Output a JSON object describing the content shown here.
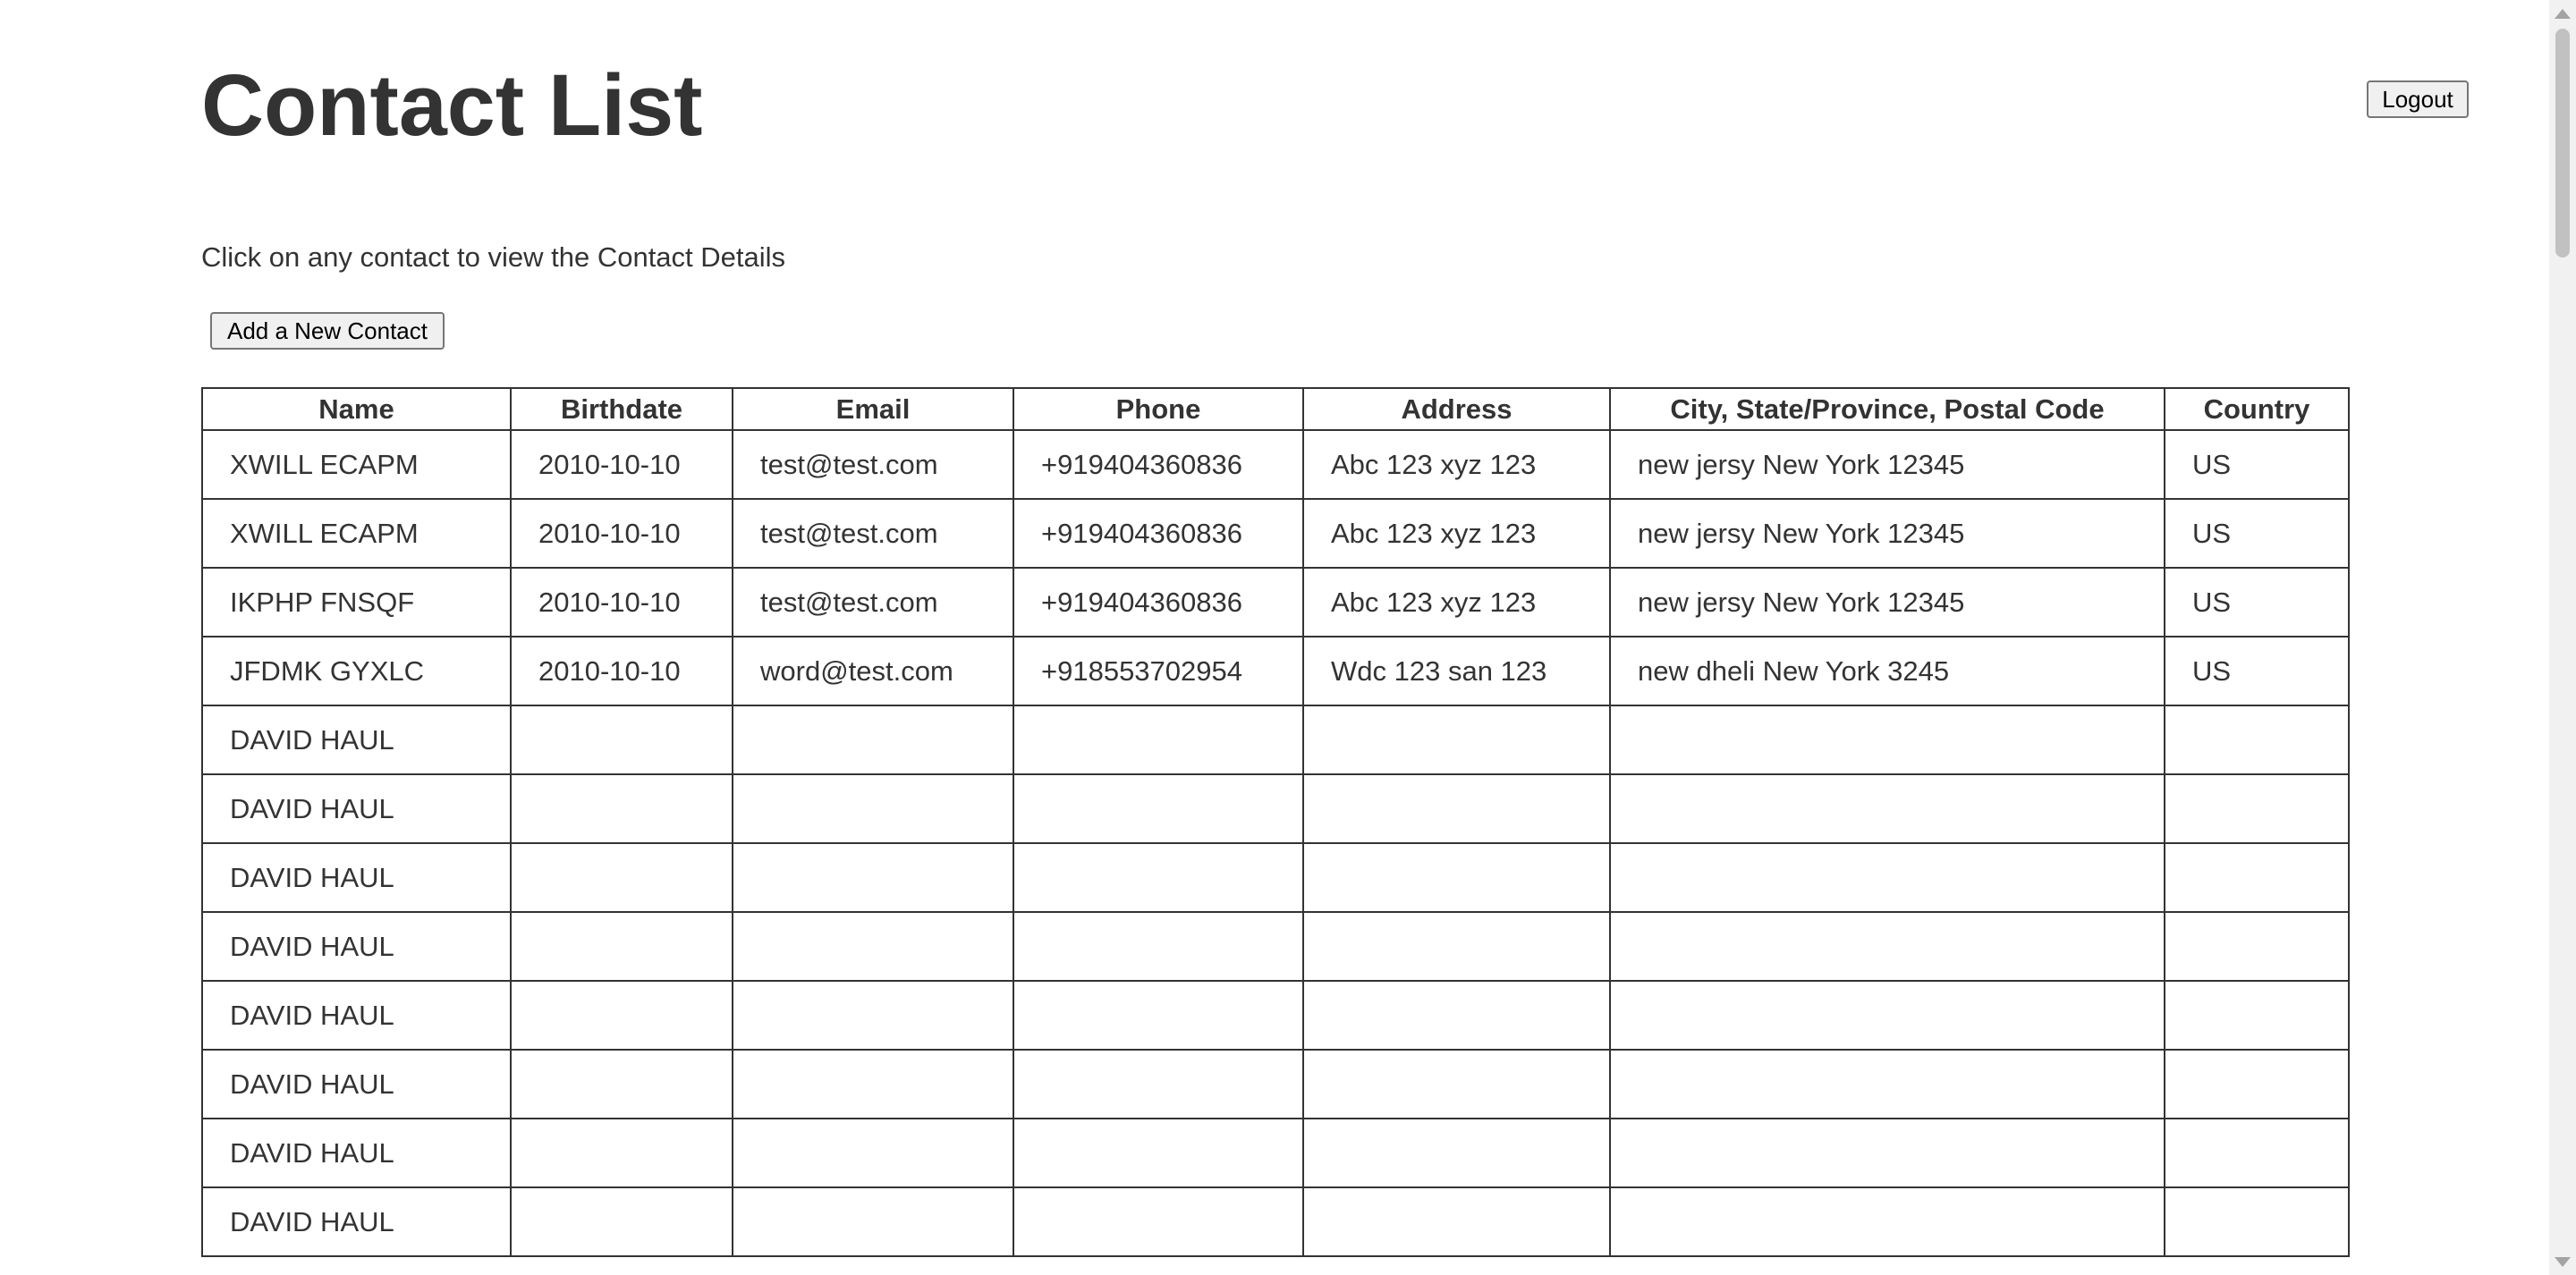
{
  "header": {
    "title": "Contact List",
    "logout_label": "Logout"
  },
  "main": {
    "instructions": "Click on any contact to view the Contact Details",
    "add_contact_label": "Add a New Contact"
  },
  "table": {
    "columns": [
      "Name",
      "Birthdate",
      "Email",
      "Phone",
      "Address",
      "City, State/Province, Postal Code",
      "Country"
    ],
    "rows": [
      [
        "XWILL ECAPM",
        "2010-10-10",
        "test@test.com",
        "+919404360836",
        "Abc 123 xyz 123",
        "new jersy New York 12345",
        "US"
      ],
      [
        "XWILL ECAPM",
        "2010-10-10",
        "test@test.com",
        "+919404360836",
        "Abc 123 xyz 123",
        "new jersy New York 12345",
        "US"
      ],
      [
        "IKPHP FNSQF",
        "2010-10-10",
        "test@test.com",
        "+919404360836",
        "Abc 123 xyz 123",
        "new jersy New York 12345",
        "US"
      ],
      [
        "JFDMK GYXLC",
        "2010-10-10",
        "word@test.com",
        "+918553702954",
        "Wdc 123 san 123",
        "new dheli New York 3245",
        "US"
      ],
      [
        "DAVID HAUL",
        "",
        "",
        "",
        "",
        "",
        ""
      ],
      [
        "DAVID HAUL",
        "",
        "",
        "",
        "",
        "",
        ""
      ],
      [
        "DAVID HAUL",
        "",
        "",
        "",
        "",
        "",
        ""
      ],
      [
        "DAVID HAUL",
        "",
        "",
        "",
        "",
        "",
        ""
      ],
      [
        "DAVID HAUL",
        "",
        "",
        "",
        "",
        "",
        ""
      ],
      [
        "DAVID HAUL",
        "",
        "",
        "",
        "",
        "",
        ""
      ],
      [
        "DAVID HAUL",
        "",
        "",
        "",
        "",
        "",
        ""
      ],
      [
        "DAVID HAUL",
        "",
        "",
        "",
        "",
        "",
        ""
      ]
    ]
  }
}
